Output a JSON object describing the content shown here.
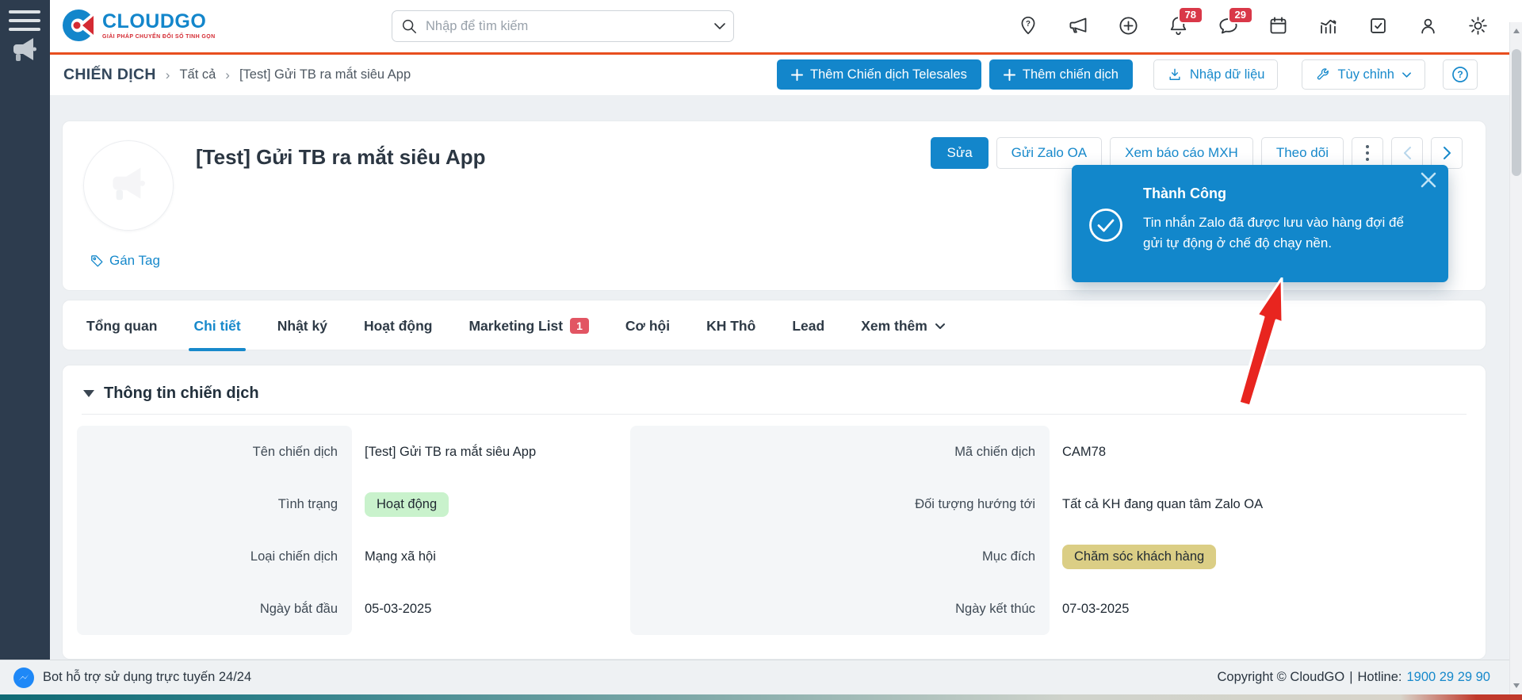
{
  "brand": {
    "name": "CLOUDGO",
    "tagline": "GIẢI PHÁP CHUYỂN ĐỔI SỐ TINH GỌN",
    "primary_color": "#1386cb",
    "accent_color": "#e84e1f"
  },
  "topbar": {
    "search": {
      "placeholder": "Nhập để tìm kiếm"
    },
    "icons": [
      {
        "name": "location-help-icon",
        "badge": ""
      },
      {
        "name": "megaphone-icon",
        "badge": ""
      },
      {
        "name": "add-circle-icon",
        "badge": ""
      },
      {
        "name": "notification-bell-icon",
        "badge": "78"
      },
      {
        "name": "chat-icon",
        "badge": "29"
      },
      {
        "name": "calendar-icon",
        "badge": ""
      },
      {
        "name": "analytics-icon",
        "badge": ""
      },
      {
        "name": "tasks-icon",
        "badge": ""
      },
      {
        "name": "user-icon",
        "badge": ""
      },
      {
        "name": "settings-gear-icon",
        "badge": ""
      }
    ]
  },
  "breadcrumb": {
    "module": "CHIẾN DỊCH",
    "separator": "›",
    "items": [
      "Tất cả",
      "[Test] Gửi TB ra mắt siêu App"
    ]
  },
  "toolbar": {
    "add_telesales": "Thêm Chiến dịch Telesales",
    "add_campaign": "Thêm chiến dịch",
    "import": "Nhập dữ liệu",
    "customize": "Tùy chỉnh",
    "help": "?"
  },
  "campaign": {
    "title": "[Test] Gửi TB ra mắt siêu App",
    "tag_link": "Gán Tag",
    "actions": {
      "edit": "Sửa",
      "send_zalo": "Gửi Zalo OA",
      "social_report": "Xem báo cáo MXH",
      "follow": "Theo dõi"
    }
  },
  "toast": {
    "title": "Thành Công",
    "message": "Tin nhắn Zalo đã được lưu vào hàng đợi để gửi tự động ở chế độ chạy nền.",
    "color": "#1287cb"
  },
  "tabs": {
    "items": [
      {
        "label": "Tổng quan",
        "active": false
      },
      {
        "label": "Chi tiết",
        "active": true
      },
      {
        "label": "Nhật ký",
        "active": false
      },
      {
        "label": "Hoạt động",
        "active": false
      },
      {
        "label": "Marketing List",
        "active": false,
        "badge": "1"
      },
      {
        "label": "Cơ hội",
        "active": false
      },
      {
        "label": "KH Thô",
        "active": false
      },
      {
        "label": "Lead",
        "active": false
      },
      {
        "label": "Xem thêm",
        "active": false,
        "dropdown": true
      }
    ]
  },
  "details": {
    "section_title": "Thông tin chiến dịch",
    "left": [
      {
        "label": "Tên chiến dịch",
        "value": "[Test] Gửi TB ra mắt siêu App"
      },
      {
        "label": "Tình trạng",
        "value": "Hoạt động",
        "pill": "green"
      },
      {
        "label": "Loại chiến dịch",
        "value": "Mạng xã hội"
      },
      {
        "label": "Ngày bắt đầu",
        "value": "05-03-2025"
      }
    ],
    "right": [
      {
        "label": "Mã chiến dịch",
        "value": "CAM78"
      },
      {
        "label": "Đối tượng hướng tới",
        "value": "Tất cả KH đang quan tâm Zalo OA"
      },
      {
        "label": "Mục đích",
        "value": "Chăm sóc khách hàng",
        "pill": "yellow"
      },
      {
        "label": "Ngày kết thúc",
        "value": "07-03-2025"
      }
    ],
    "pill_colors": {
      "green": "#c9f2cc",
      "yellow": "#dbce85"
    }
  },
  "footer": {
    "support": "Bot hỗ trợ sử dụng trực tuyến 24/24",
    "copyright": "Copyright © CloudGO",
    "divider": "|",
    "hotline_label": "Hotline:",
    "hotline_number": "1900 29 29 90"
  }
}
